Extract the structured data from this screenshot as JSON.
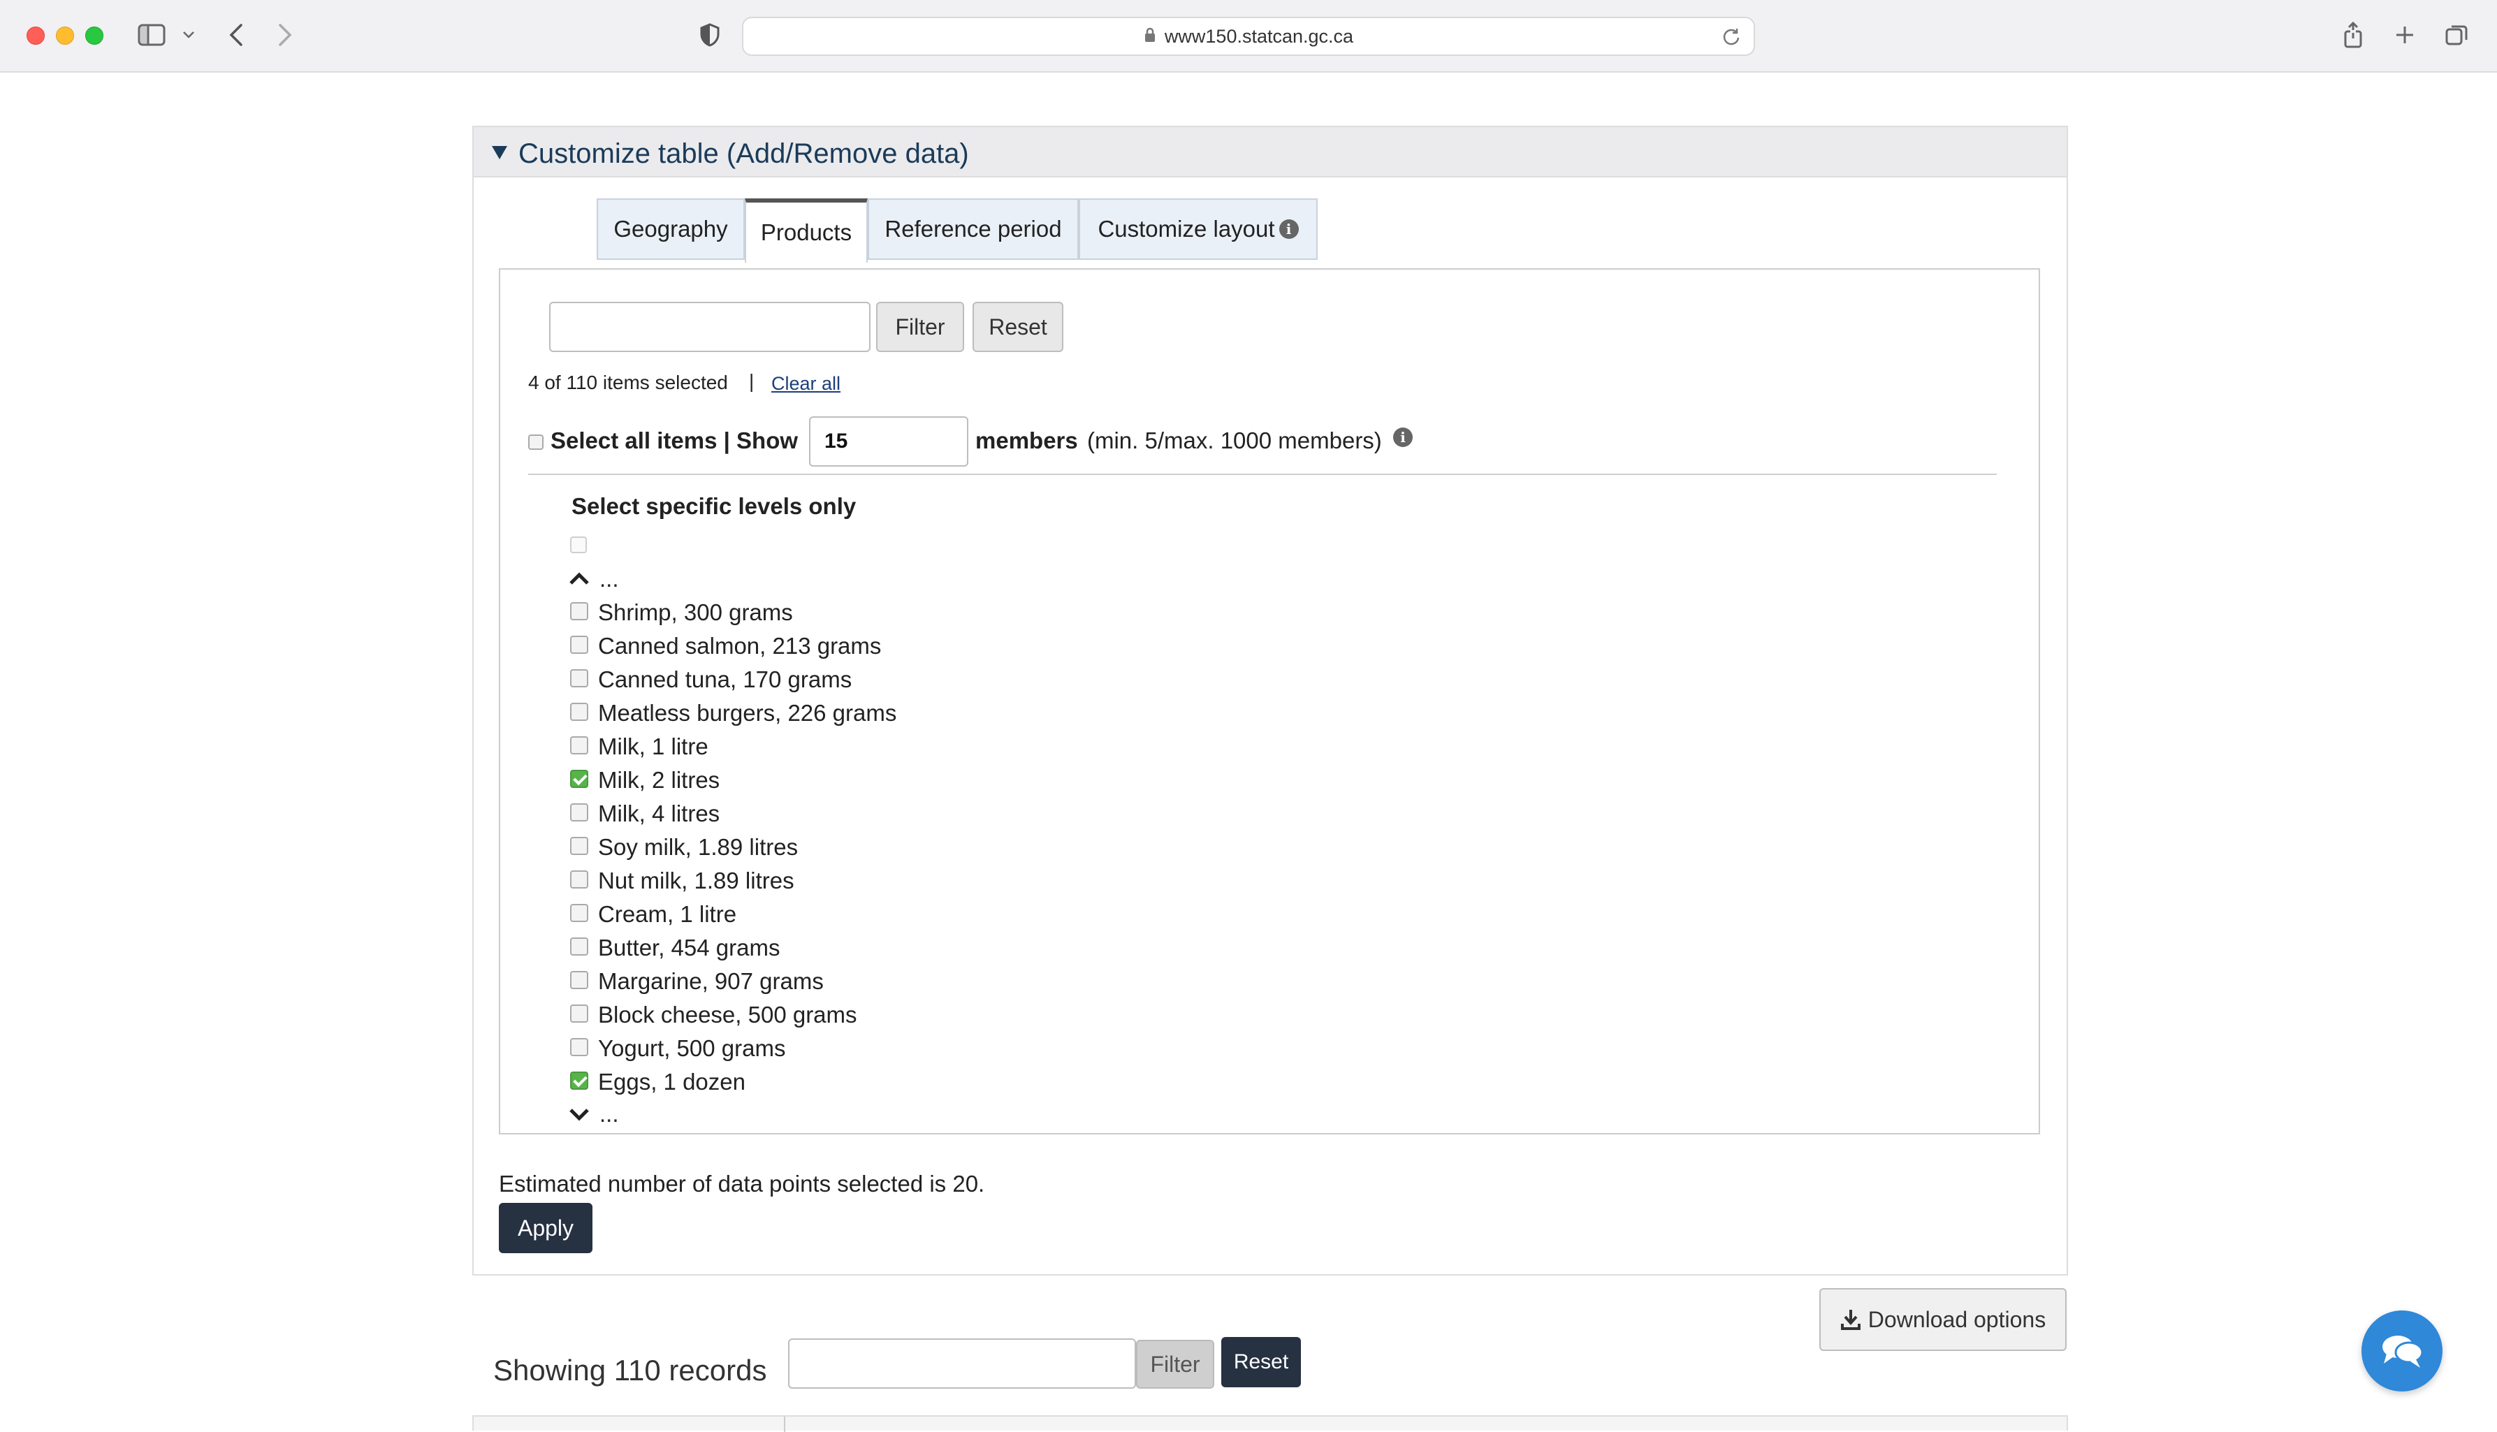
{
  "browser": {
    "url": "www150.statcan.gc.ca"
  },
  "panel": {
    "title": "Customize table (Add/Remove data)"
  },
  "tabs": [
    {
      "label": "Geography"
    },
    {
      "label": "Products"
    },
    {
      "label": "Reference period"
    },
    {
      "label": "Customize layout"
    }
  ],
  "filter": {
    "input_value": "",
    "filter_label": "Filter",
    "reset_label": "Reset"
  },
  "selection": {
    "count_text": "4 of 110 items selected",
    "separator": "|",
    "clear_all": "Clear all"
  },
  "show_row": {
    "select_all": "Select all items | Show",
    "show_value": "15",
    "members_bold": "members",
    "members_note": "(min. 5/max. 1000 members)"
  },
  "levels": {
    "heading": "Select specific levels only"
  },
  "list": {
    "ellipsis_top": "...",
    "ellipsis_bottom": "...",
    "items": [
      {
        "label": "Shrimp, 300 grams",
        "checked": false
      },
      {
        "label": "Canned salmon, 213 grams",
        "checked": false
      },
      {
        "label": "Canned tuna, 170 grams",
        "checked": false
      },
      {
        "label": "Meatless burgers, 226 grams",
        "checked": false
      },
      {
        "label": "Milk, 1 litre",
        "checked": false
      },
      {
        "label": "Milk, 2 litres",
        "checked": true
      },
      {
        "label": "Milk, 4 litres",
        "checked": false
      },
      {
        "label": "Soy milk, 1.89 litres",
        "checked": false
      },
      {
        "label": "Nut milk, 1.89 litres",
        "checked": false
      },
      {
        "label": "Cream, 1 litre",
        "checked": false
      },
      {
        "label": "Butter, 454 grams",
        "checked": false
      },
      {
        "label": "Margarine, 907 grams",
        "checked": false
      },
      {
        "label": "Block cheese, 500 grams",
        "checked": false
      },
      {
        "label": "Yogurt, 500 grams",
        "checked": false
      },
      {
        "label": "Eggs, 1 dozen",
        "checked": true
      }
    ]
  },
  "estimate": {
    "text": "Estimated number of data points selected is 20.",
    "apply_label": "Apply"
  },
  "records": {
    "download_label": "Download options",
    "showing_text": "Showing 110 records",
    "filter_label": "Filter",
    "reset_label": "Reset"
  },
  "colors": {
    "accent_dark": "#263142",
    "title_blue": "#1b3b5a",
    "check_green": "#58b44a",
    "chat_blue": "#2f88d8"
  }
}
